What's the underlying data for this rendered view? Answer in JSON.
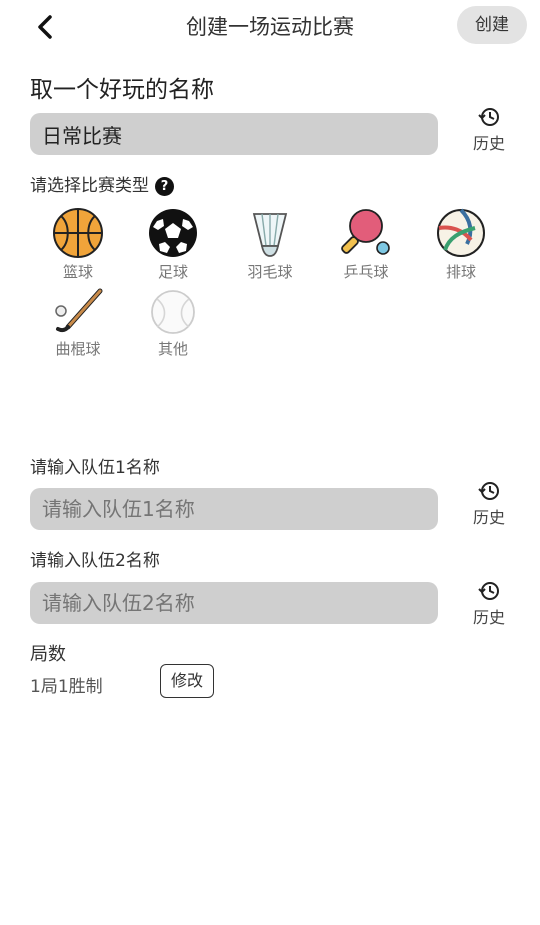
{
  "header": {
    "title": "创建一场运动比赛",
    "create_label": "创建"
  },
  "name_section": {
    "title": "取一个好玩的名称",
    "value": "日常比赛",
    "history_label": "历史"
  },
  "type_section": {
    "title": "请选择比赛类型",
    "help_symbol": "?"
  },
  "sports": [
    {
      "label": "篮球",
      "icon": "basketball-icon"
    },
    {
      "label": "足球",
      "icon": "soccer-ball-icon"
    },
    {
      "label": "羽毛球",
      "icon": "shuttlecock-icon"
    },
    {
      "label": "乒乓球",
      "icon": "ping-pong-paddle-icon"
    },
    {
      "label": "排球",
      "icon": "volleyball-icon"
    },
    {
      "label": "曲棍球",
      "icon": "hockey-stick-icon"
    },
    {
      "label": "其他",
      "icon": "other-ball-icon"
    }
  ],
  "team1": {
    "label": "请输入队伍1名称",
    "placeholder": "请输入队伍1名称",
    "history_label": "历史"
  },
  "team2": {
    "label": "请输入队伍2名称",
    "placeholder": "请输入队伍2名称",
    "history_label": "历史"
  },
  "rounds": {
    "title": "局数",
    "value": "1局1胜制",
    "modify_label": "修改"
  },
  "colors": {
    "field_bg": "#cfcfcf",
    "create_bg": "#e3e3e3",
    "basketball": "#f0a43a",
    "pingpong": "#e25d7a"
  }
}
